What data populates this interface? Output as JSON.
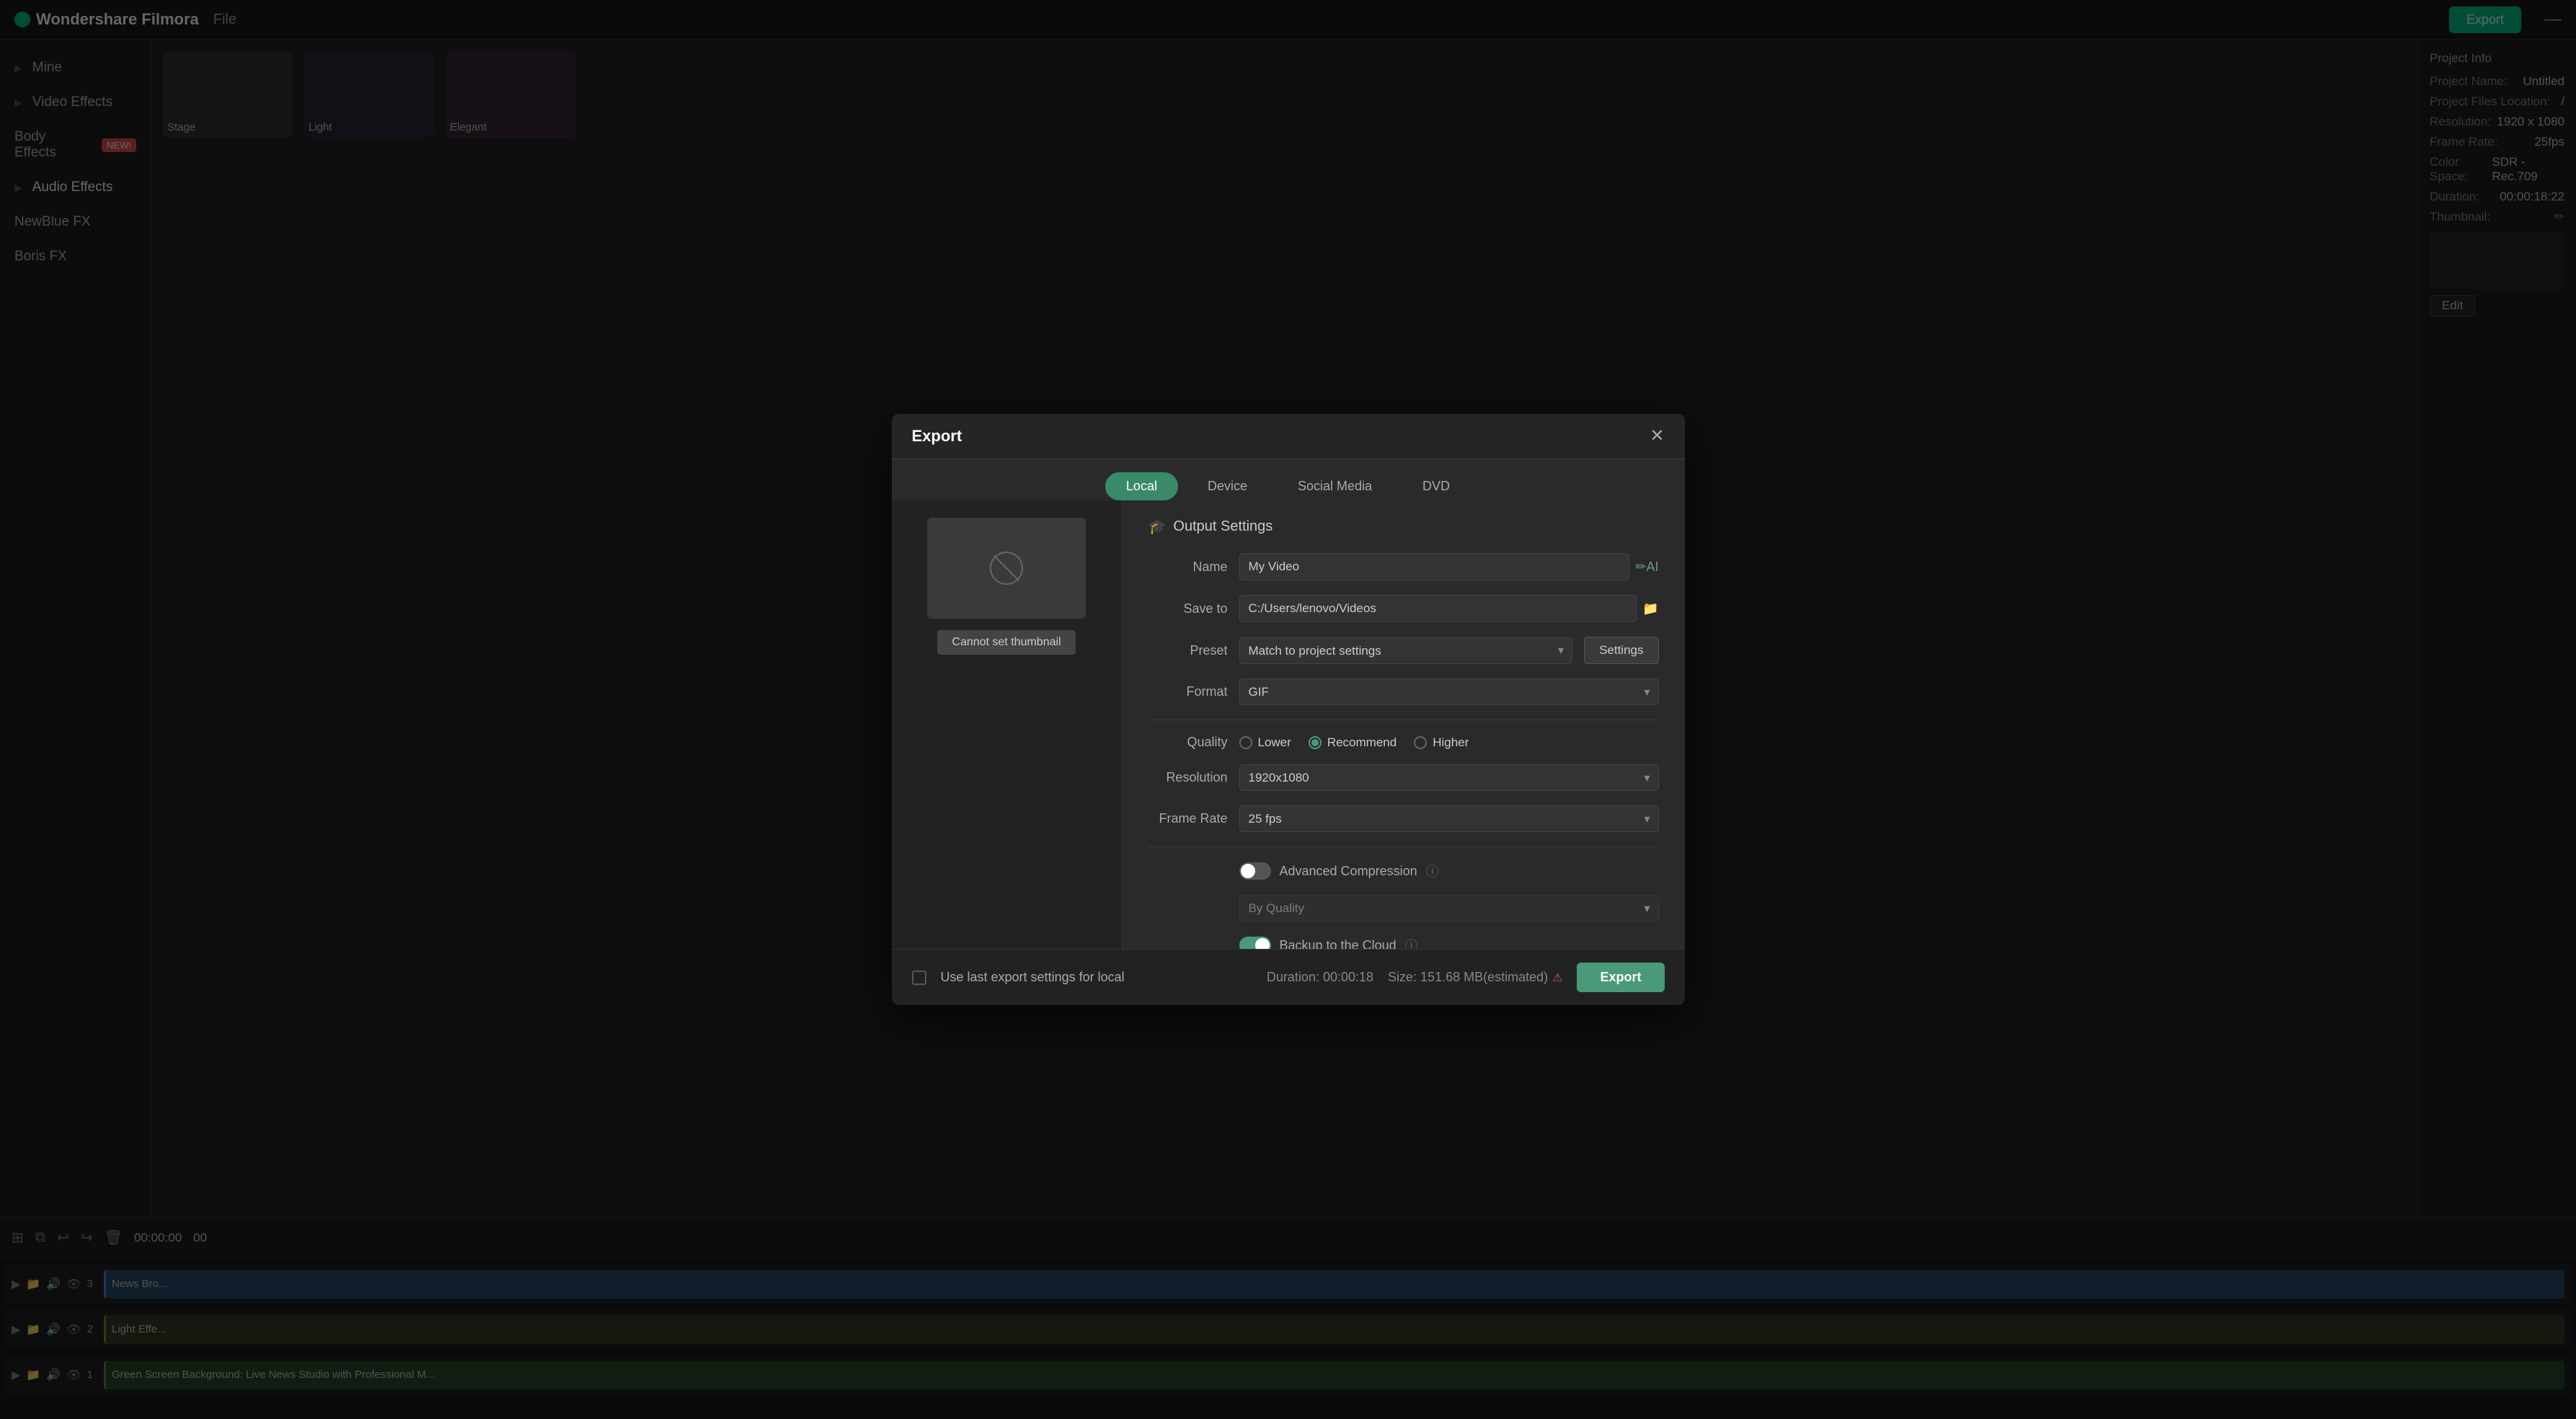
{
  "app": {
    "name": "Wondershare Filmora",
    "menu": "File",
    "export_label": "Export",
    "minimize_label": "—"
  },
  "sidebar": {
    "items": [
      {
        "id": "mine",
        "label": "Mine",
        "arrow": "▶"
      },
      {
        "id": "video-effects",
        "label": "Video Effects",
        "arrow": "▶"
      },
      {
        "id": "body-effects",
        "label": "Body Effects",
        "badge": "NEW!"
      },
      {
        "id": "audio-effects",
        "label": "Audio Effects",
        "arrow": "▶"
      },
      {
        "id": "newblue-fx",
        "label": "NewBlue FX"
      },
      {
        "id": "boris-fx",
        "label": "Boris FX"
      }
    ]
  },
  "media_items": [
    {
      "label": "Stage",
      "type": "image"
    },
    {
      "label": "Light",
      "type": "image"
    },
    {
      "label": "Elegant",
      "type": "image"
    }
  ],
  "right_panel": {
    "title": "Project Info",
    "fields": [
      {
        "label": "Project Name:",
        "value": "Untitled"
      },
      {
        "label": "Project Files Location:",
        "value": "/"
      },
      {
        "label": "Resolution:",
        "value": "1920 x 1080"
      },
      {
        "label": "Frame Rate:",
        "value": "25fps"
      },
      {
        "label": "Color Space:",
        "value": "SDR - Rec.709"
      },
      {
        "label": "Duration:",
        "value": "00:00:18:22"
      },
      {
        "label": "Thumbnail:",
        "value": ""
      }
    ],
    "edit_label": "Edit"
  },
  "timeline": {
    "tracks": [
      {
        "number": "3",
        "label": "News Bro..."
      },
      {
        "number": "2",
        "label": "Light Effe..."
      },
      {
        "number": "1",
        "label": "Green Screen Background: Live News Studio with Professional M..."
      }
    ],
    "time_start": "00:00:00",
    "time_end": "00"
  },
  "modal": {
    "title": "Export",
    "close_label": "✕",
    "tabs": [
      {
        "id": "local",
        "label": "Local",
        "active": true
      },
      {
        "id": "device",
        "label": "Device"
      },
      {
        "id": "social-media",
        "label": "Social Media"
      },
      {
        "id": "dvd",
        "label": "DVD"
      }
    ],
    "preview": {
      "cannot_set_label": "Cannot set thumbnail"
    },
    "settings": {
      "header_label": "Output Settings",
      "header_icon": "🎓",
      "fields": {
        "name_label": "Name",
        "name_value": "My Video",
        "name_icon": "✏️",
        "save_to_label": "Save to",
        "save_to_value": "C:/Users/lenovo/Videos",
        "save_to_icon": "📁",
        "preset_label": "Preset",
        "preset_value": "Match to project settings",
        "settings_btn_label": "Settings",
        "format_label": "Format",
        "format_value": "GIF",
        "quality_label": "Quality",
        "quality_options": [
          {
            "id": "lower",
            "label": "Lower",
            "checked": false
          },
          {
            "id": "recommend",
            "label": "Recommend",
            "checked": true
          },
          {
            "id": "higher",
            "label": "Higher",
            "checked": false
          }
        ],
        "resolution_label": "Resolution",
        "resolution_value": "1920x1080",
        "frame_rate_label": "Frame Rate",
        "frame_rate_value": "25 fps",
        "advanced_compression_label": "Advanced Compression",
        "advanced_compression_enabled": false,
        "by_quality_label": "By Quality",
        "by_quality_enabled": false,
        "backup_cloud_label": "Backup to the Cloud",
        "backup_cloud_enabled": true
      }
    },
    "footer": {
      "checkbox_label": "Use last export settings for local",
      "duration_label": "Duration: 00:00:18",
      "size_label": "Size: 151.68 MB(estimated)",
      "export_label": "Export"
    }
  }
}
